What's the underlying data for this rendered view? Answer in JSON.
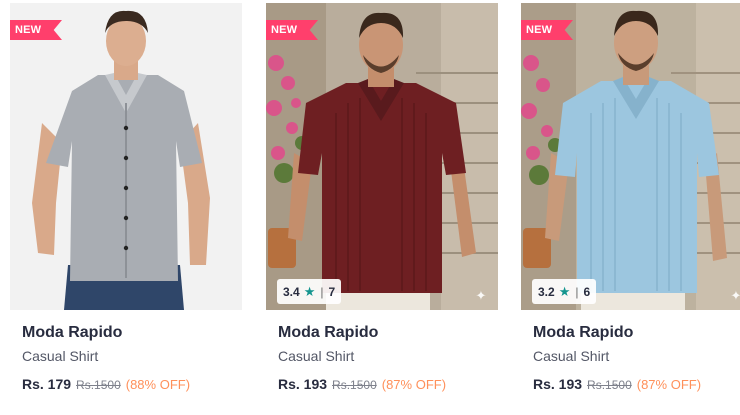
{
  "colors": {
    "new_badge": "#ff3f6c",
    "rating_star": "#14958f",
    "discount": "#ff905a",
    "brand_text": "#282c3f"
  },
  "products": [
    {
      "badge": "NEW",
      "rating": null,
      "rating_count": null,
      "brand": "Moda Rapido",
      "name": "Casual Shirt",
      "price": "Rs. 179",
      "mrp": "Rs.1500",
      "discount": "(88% OFF)",
      "shirt_color": "#a9adb3",
      "background": "studio-white"
    },
    {
      "badge": "NEW",
      "rating": "3.4",
      "rating_count": "7",
      "brand": "Moda Rapido",
      "name": "Casual Shirt",
      "price": "Rs. 193",
      "mrp": "Rs.1500",
      "discount": "(87% OFF)",
      "shirt_color": "#6e1f22",
      "background": "stone-stairs"
    },
    {
      "badge": "NEW",
      "rating": "3.2",
      "rating_count": "6",
      "brand": "Moda Rapido",
      "name": "Casual Shirt",
      "price": "Rs. 193",
      "mrp": "Rs.1500",
      "discount": "(87% OFF)",
      "shirt_color": "#9cc6df",
      "background": "stone-stairs"
    }
  ]
}
